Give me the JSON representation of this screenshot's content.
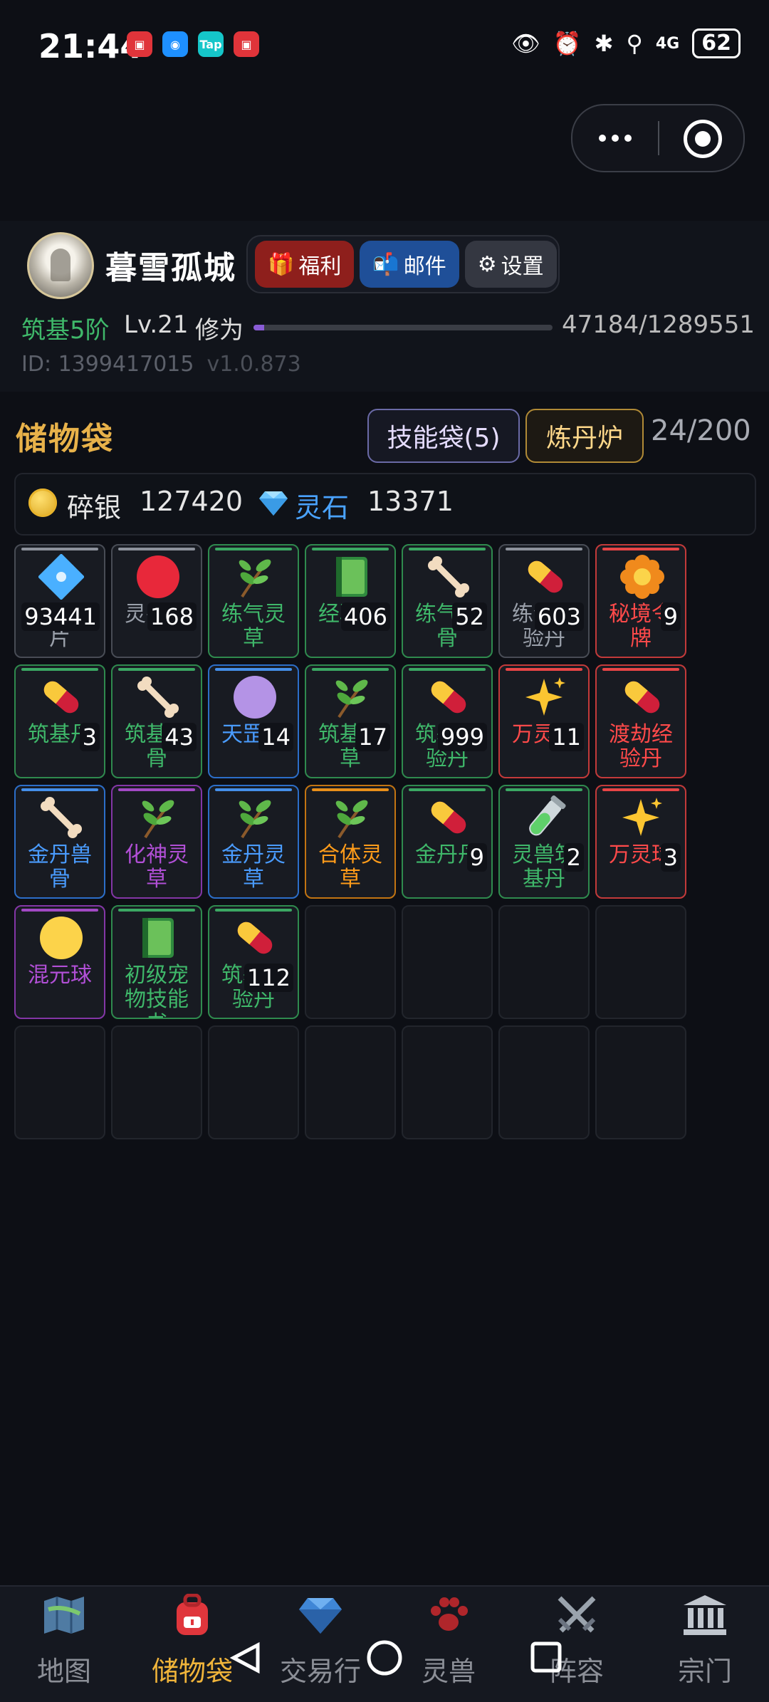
{
  "status_bar": {
    "time": "21:44",
    "battery": "62",
    "signal": "4G"
  },
  "profile": {
    "name": "暮雪孤城",
    "buttons": {
      "welfare": "福利",
      "mail": "邮件",
      "settings": "设置"
    },
    "realm": "筑基5阶",
    "level": "Lv.21",
    "xiuwei_label": "修为",
    "xp_text": "47184/1289551",
    "xp_fraction": 0.0366,
    "id_text": "ID: 1399417015",
    "version": "v1.0.873"
  },
  "storage": {
    "title": "储物袋",
    "skill_bag": "技能袋(5)",
    "furnace": "炼丹炉",
    "capacity": "24/200"
  },
  "currency": {
    "silver_label": "碎银",
    "silver_value": "127420",
    "stone_label": "灵石",
    "stone_value": "13371"
  },
  "items": [
    {
      "name": "灵石碎片",
      "qty": "93441",
      "rarity": "gray",
      "icon": "crystal-icon"
    },
    {
      "name": "灵兽球",
      "qty": "168",
      "rarity": "gray",
      "icon": "red-ball-icon"
    },
    {
      "name": "练气灵草",
      "qty": "",
      "rarity": "green",
      "icon": "herb-icon"
    },
    {
      "name": "经验丹",
      "qty": "406",
      "rarity": "green",
      "icon": "green-book-icon"
    },
    {
      "name": "练气兽骨",
      "qty": "52",
      "rarity": "green",
      "icon": "bone-icon"
    },
    {
      "name": "练气经验丹",
      "qty": "603",
      "rarity": "gray",
      "icon": "pill-icon"
    },
    {
      "name": "秘境令牌",
      "qty": "9",
      "rarity": "red",
      "icon": "flower-icon"
    },
    {
      "name": "筑基丹",
      "qty": "3",
      "rarity": "green",
      "icon": "pill-icon"
    },
    {
      "name": "筑基兽骨",
      "qty": "43",
      "rarity": "green",
      "icon": "bone-icon"
    },
    {
      "name": "天罡球",
      "qty": "14",
      "rarity": "blue",
      "icon": "purple-ball-icon"
    },
    {
      "name": "筑基灵草",
      "qty": "17",
      "rarity": "green",
      "icon": "herb-icon"
    },
    {
      "name": "筑基经验丹",
      "qty": "999",
      "rarity": "green",
      "icon": "pill-icon"
    },
    {
      "name": "万灵球",
      "qty": "11",
      "rarity": "red",
      "icon": "sparkle-icon"
    },
    {
      "name": "渡劫经验丹",
      "qty": "",
      "rarity": "red",
      "icon": "pill-icon"
    },
    {
      "name": "金丹兽骨",
      "qty": "",
      "rarity": "blue",
      "icon": "bone-icon"
    },
    {
      "name": "化神灵草",
      "qty": "",
      "rarity": "purple",
      "icon": "herb-icon"
    },
    {
      "name": "金丹灵草",
      "qty": "",
      "rarity": "blue",
      "icon": "herb-icon"
    },
    {
      "name": "合体灵草",
      "qty": "",
      "rarity": "orange",
      "icon": "herb-icon"
    },
    {
      "name": "金丹丹",
      "qty": "9",
      "rarity": "green",
      "icon": "pill-icon"
    },
    {
      "name": "灵兽筑基丹",
      "qty": "2",
      "rarity": "green",
      "icon": "flask-icon"
    },
    {
      "name": "万灵球",
      "qty": "3",
      "rarity": "red",
      "icon": "sparkle-icon"
    },
    {
      "name": "混元球",
      "qty": "",
      "rarity": "purple",
      "icon": "yellow-ball-icon"
    },
    {
      "name": "初级宠物技能书",
      "qty": "",
      "rarity": "green",
      "icon": "green-book-icon"
    },
    {
      "name": "筑基经验丹",
      "qty": "112",
      "rarity": "green",
      "icon": "pill-icon"
    }
  ],
  "empty_slots": 11,
  "nav": [
    {
      "label": "地图",
      "icon": "map-icon"
    },
    {
      "label": "储物袋",
      "icon": "backpack-icon",
      "active": true
    },
    {
      "label": "交易行",
      "icon": "diamond-icon"
    },
    {
      "label": "灵兽",
      "icon": "paw-icon"
    },
    {
      "label": "阵容",
      "icon": "swords-icon"
    },
    {
      "label": "宗门",
      "icon": "temple-icon"
    }
  ]
}
